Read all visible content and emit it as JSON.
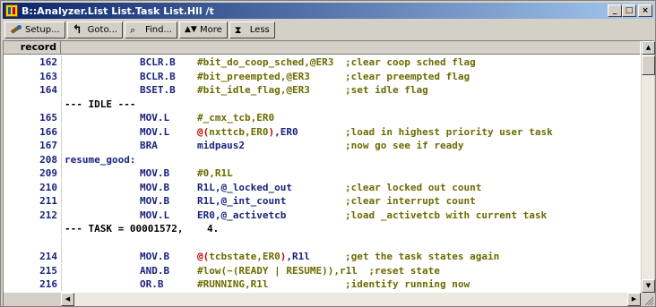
{
  "window": {
    "title": "B::Analyzer.List List.Task List.Hll /t",
    "minimize": "_",
    "maximize": "□",
    "close": "×"
  },
  "toolbar": {
    "setup": "Setup...",
    "goto": "Goto...",
    "find": "Find...",
    "more": "More",
    "less": "Less"
  },
  "header": {
    "record": "record"
  },
  "rows": [
    {
      "rec": "162",
      "mn": "BCLR.B",
      "op": "#bit_do_coop_sched,@ER3",
      "cm": ";clear coop sched flag"
    },
    {
      "rec": "163",
      "mn": "BCLR.B",
      "op": "#bit_preempted,@ER3",
      "cm": ";clear preempted flag"
    },
    {
      "rec": "164",
      "mn": "BSET.B",
      "op": "#bit_idle_flag,@ER3",
      "cm": ";set idle flag"
    },
    {
      "mark": "--- IDLE ---"
    },
    {
      "rec": "165",
      "mn": "MOV.L",
      "op": "#_cmx_tcb,ER0",
      "cm": ""
    },
    {
      "rec": "166",
      "mn": "MOV.L",
      "op": "@(nxttcb,ER0),ER0",
      "cm": ";load in highest priority user task"
    },
    {
      "rec": "167",
      "mn": "BRA",
      "op": "midpaus2",
      "cm": ";now go see if ready"
    },
    {
      "rec": "208",
      "lbl": "resume_good:"
    },
    {
      "rec": "209",
      "mn": "MOV.B",
      "op": "#0,R1L",
      "cm": ""
    },
    {
      "rec": "210",
      "mn": "MOV.B",
      "op": "R1L,@_locked_out",
      "cm": ";clear locked out count"
    },
    {
      "rec": "211",
      "mn": "MOV.B",
      "op": "R1L,@_int_count",
      "cm": ";clear interrupt count"
    },
    {
      "rec": "212",
      "mn": "MOV.L",
      "op": "ER0,@_activetcb",
      "cm": ";load _activetcb with current task"
    },
    {
      "mark": "--- TASK = 00001572,    4."
    },
    {
      "blank": ""
    },
    {
      "rec": "214",
      "mn": "MOV.B",
      "op": "@(tcbstate,ER0),R1l",
      "cm": ";get the task states again"
    },
    {
      "rec": "215",
      "mn": "AND.B",
      "op": "#low(~(READY | RESUME)),r1l",
      "cm": ";reset state"
    },
    {
      "rec": "216",
      "mn": "OR.B",
      "op": "#RUNNING,R1l",
      "cm": ";identify running now"
    }
  ]
}
